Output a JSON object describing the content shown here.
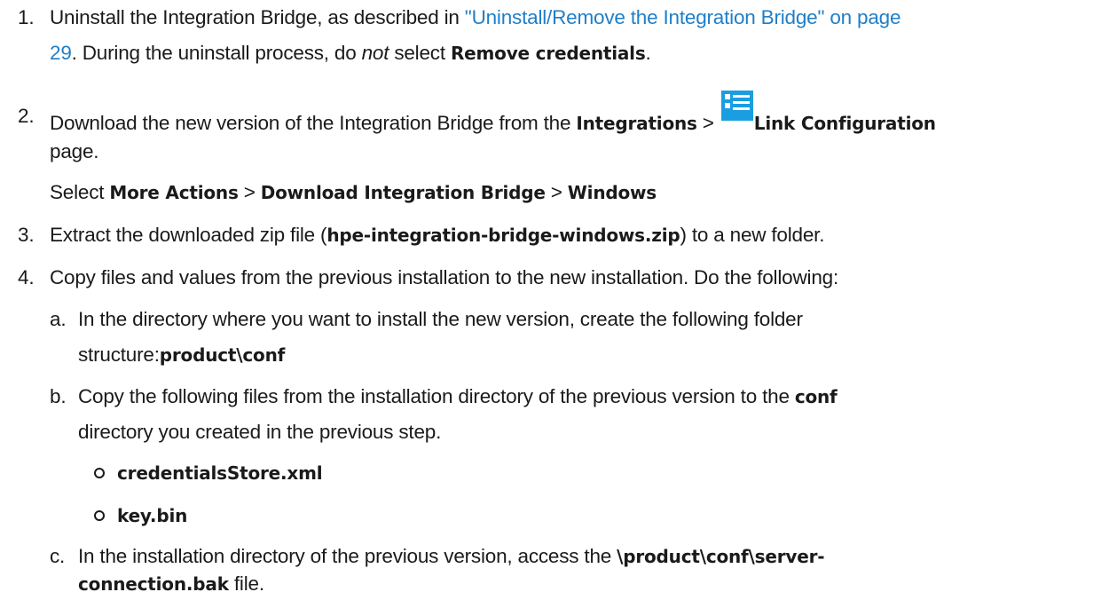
{
  "steps": [
    {
      "number": "1.",
      "line1_pre": "Uninstall the Integration Bridge, as described in ",
      "link_line1": "\"Uninstall/Remove the Integration Bridge\" on page",
      "link_line2": "29",
      "line2_post_a": ". During the uninstall process, do ",
      "line2_italic": "not",
      "line2_post_b": " select ",
      "line2_bold": "Remove credentials",
      "line2_end": "."
    },
    {
      "number": "2.",
      "line1_pre": "Download the new version of the Integration Bridge from the ",
      "bold_integrations": "Integrations",
      "sep": " > ",
      "icon": "link-configuration-icon",
      "bold_link_config": "Link Configuration",
      "line2": "page.",
      "sub_pre": "Select ",
      "more_actions": "More Actions",
      "sep2": " > ",
      "download_bridge": "Download Integration Bridge",
      "sep3": " > ",
      "windows": "Windows"
    },
    {
      "number": "3.",
      "pre": "Extract the downloaded zip file (",
      "bold": "hpe-integration-bridge-windows.zip",
      "post": ") to a new folder."
    },
    {
      "number": "4.",
      "text": "Copy files and values from the previous installation to the new installation. Do the following:",
      "substeps": [
        {
          "letter": "a.",
          "line1": "In the directory where you want to install the new version, create the following folder",
          "line2_pre": "structure:",
          "line2_bold": "product\\conf"
        },
        {
          "letter": "b.",
          "line1_pre": "Copy the following files from the installation directory of the previous version to the ",
          "line1_bold": "conf",
          "line2": "directory you created in the previous step.",
          "bullets": [
            "credentialsStore.xml",
            "key.bin"
          ]
        },
        {
          "letter": "c.",
          "line1_pre": "In the installation directory of the previous version, access the ",
          "line1_bold": "\\product\\conf\\server-",
          "line2_bold": "connection.bak",
          "line2_post": " file."
        }
      ]
    }
  ]
}
